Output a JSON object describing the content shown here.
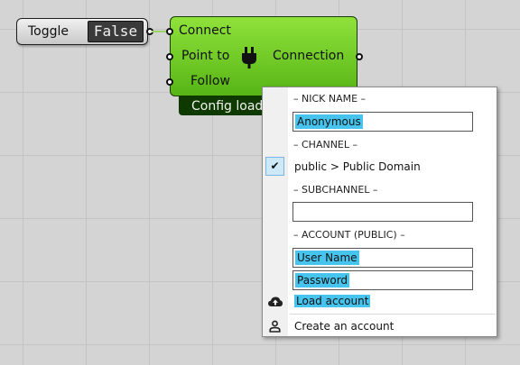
{
  "toggle": {
    "label": "Toggle",
    "value": "False"
  },
  "node": {
    "inputs": [
      "Connect",
      "Point to",
      "Follow"
    ],
    "output": "Connection",
    "config_label": "Config load"
  },
  "menu": {
    "nick_header": "– NICK NAME –",
    "nick_value": "Anonymous",
    "channel_header": "– CHANNEL –",
    "channel_item": "public > Public Domain",
    "channel_checked": true,
    "subchannel_header": "– SUBCHANNEL –",
    "subchannel_value": "",
    "account_header": "– ACCOUNT (PUBLIC) –",
    "username_value": "User Name",
    "password_value": "Password",
    "load_account": "Load account",
    "create_account": "Create an account",
    "highlight_color": "#46c4ee"
  },
  "icons": {
    "plug": "plug-icon",
    "check": "check-icon",
    "cloud_upload": "cloud-upload-icon",
    "user": "user-icon"
  }
}
